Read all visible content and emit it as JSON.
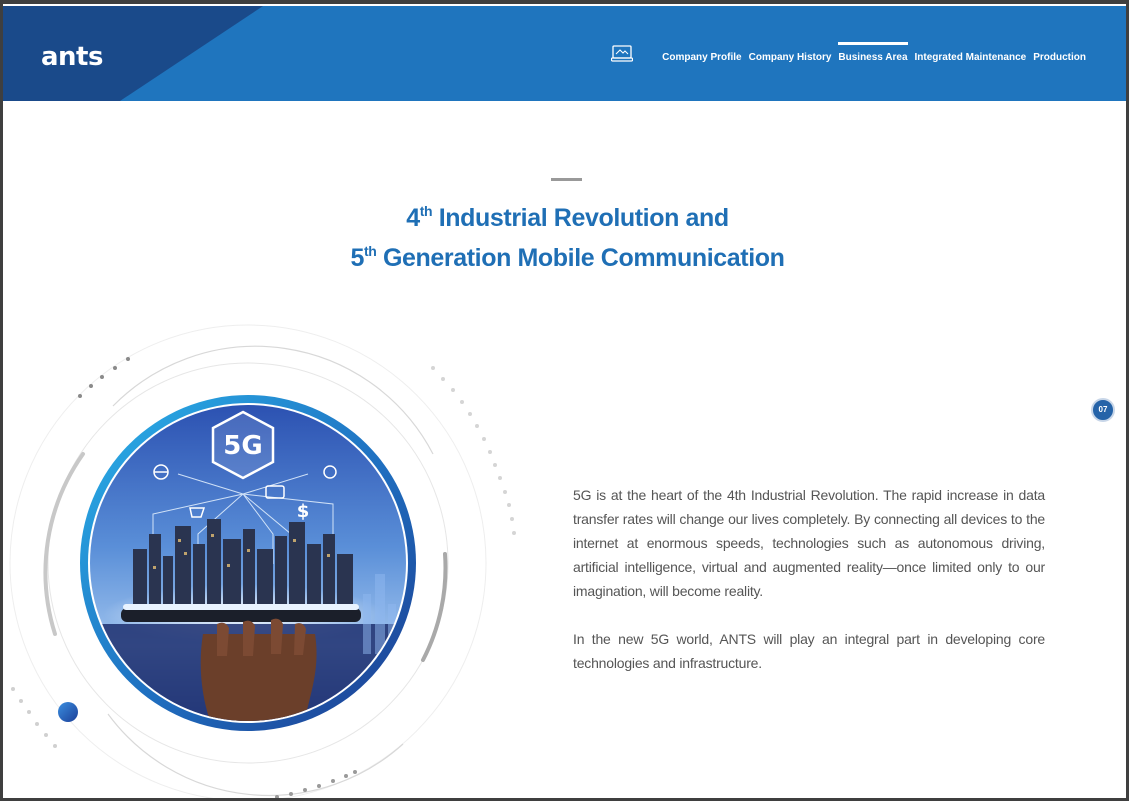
{
  "header": {
    "logo": "ants",
    "nav_icon": "monitor-icon",
    "nav_items": [
      {
        "label": "Company Profile",
        "active": false
      },
      {
        "label": "Company History",
        "active": false
      },
      {
        "label": "Business Area",
        "active": true
      },
      {
        "label": "Integrated Maintenance",
        "active": false
      },
      {
        "label": "Production",
        "active": false
      }
    ]
  },
  "title": {
    "line1_sup": "4",
    "line1_sup_text": "th",
    "line1_rest": " Industrial Revolution and",
    "line2_sup": "5",
    "line2_sup_text": "th",
    "line2_rest": " Generation Mobile Communication"
  },
  "illustration": {
    "badge_text": "5G"
  },
  "body": {
    "paragraph1": "5G is at the heart of the 4th Industrial Revolution. The rapid increase in data transfer rates will change our lives completely. By connecting all devices to the internet at enormous speeds, technologies such as autonomous driving, artificial intelligence, virtual and augmented reality—once limited only to our imagination, will become reality.",
    "paragraph2": "In the new 5G world, ANTS will play an integral part in developing core technologies and infrastructure."
  },
  "page_number": "07",
  "colors": {
    "brand_blue": "#1f75be",
    "dark_blue": "#1a4a8a",
    "title_blue": "#1f6fb5"
  }
}
